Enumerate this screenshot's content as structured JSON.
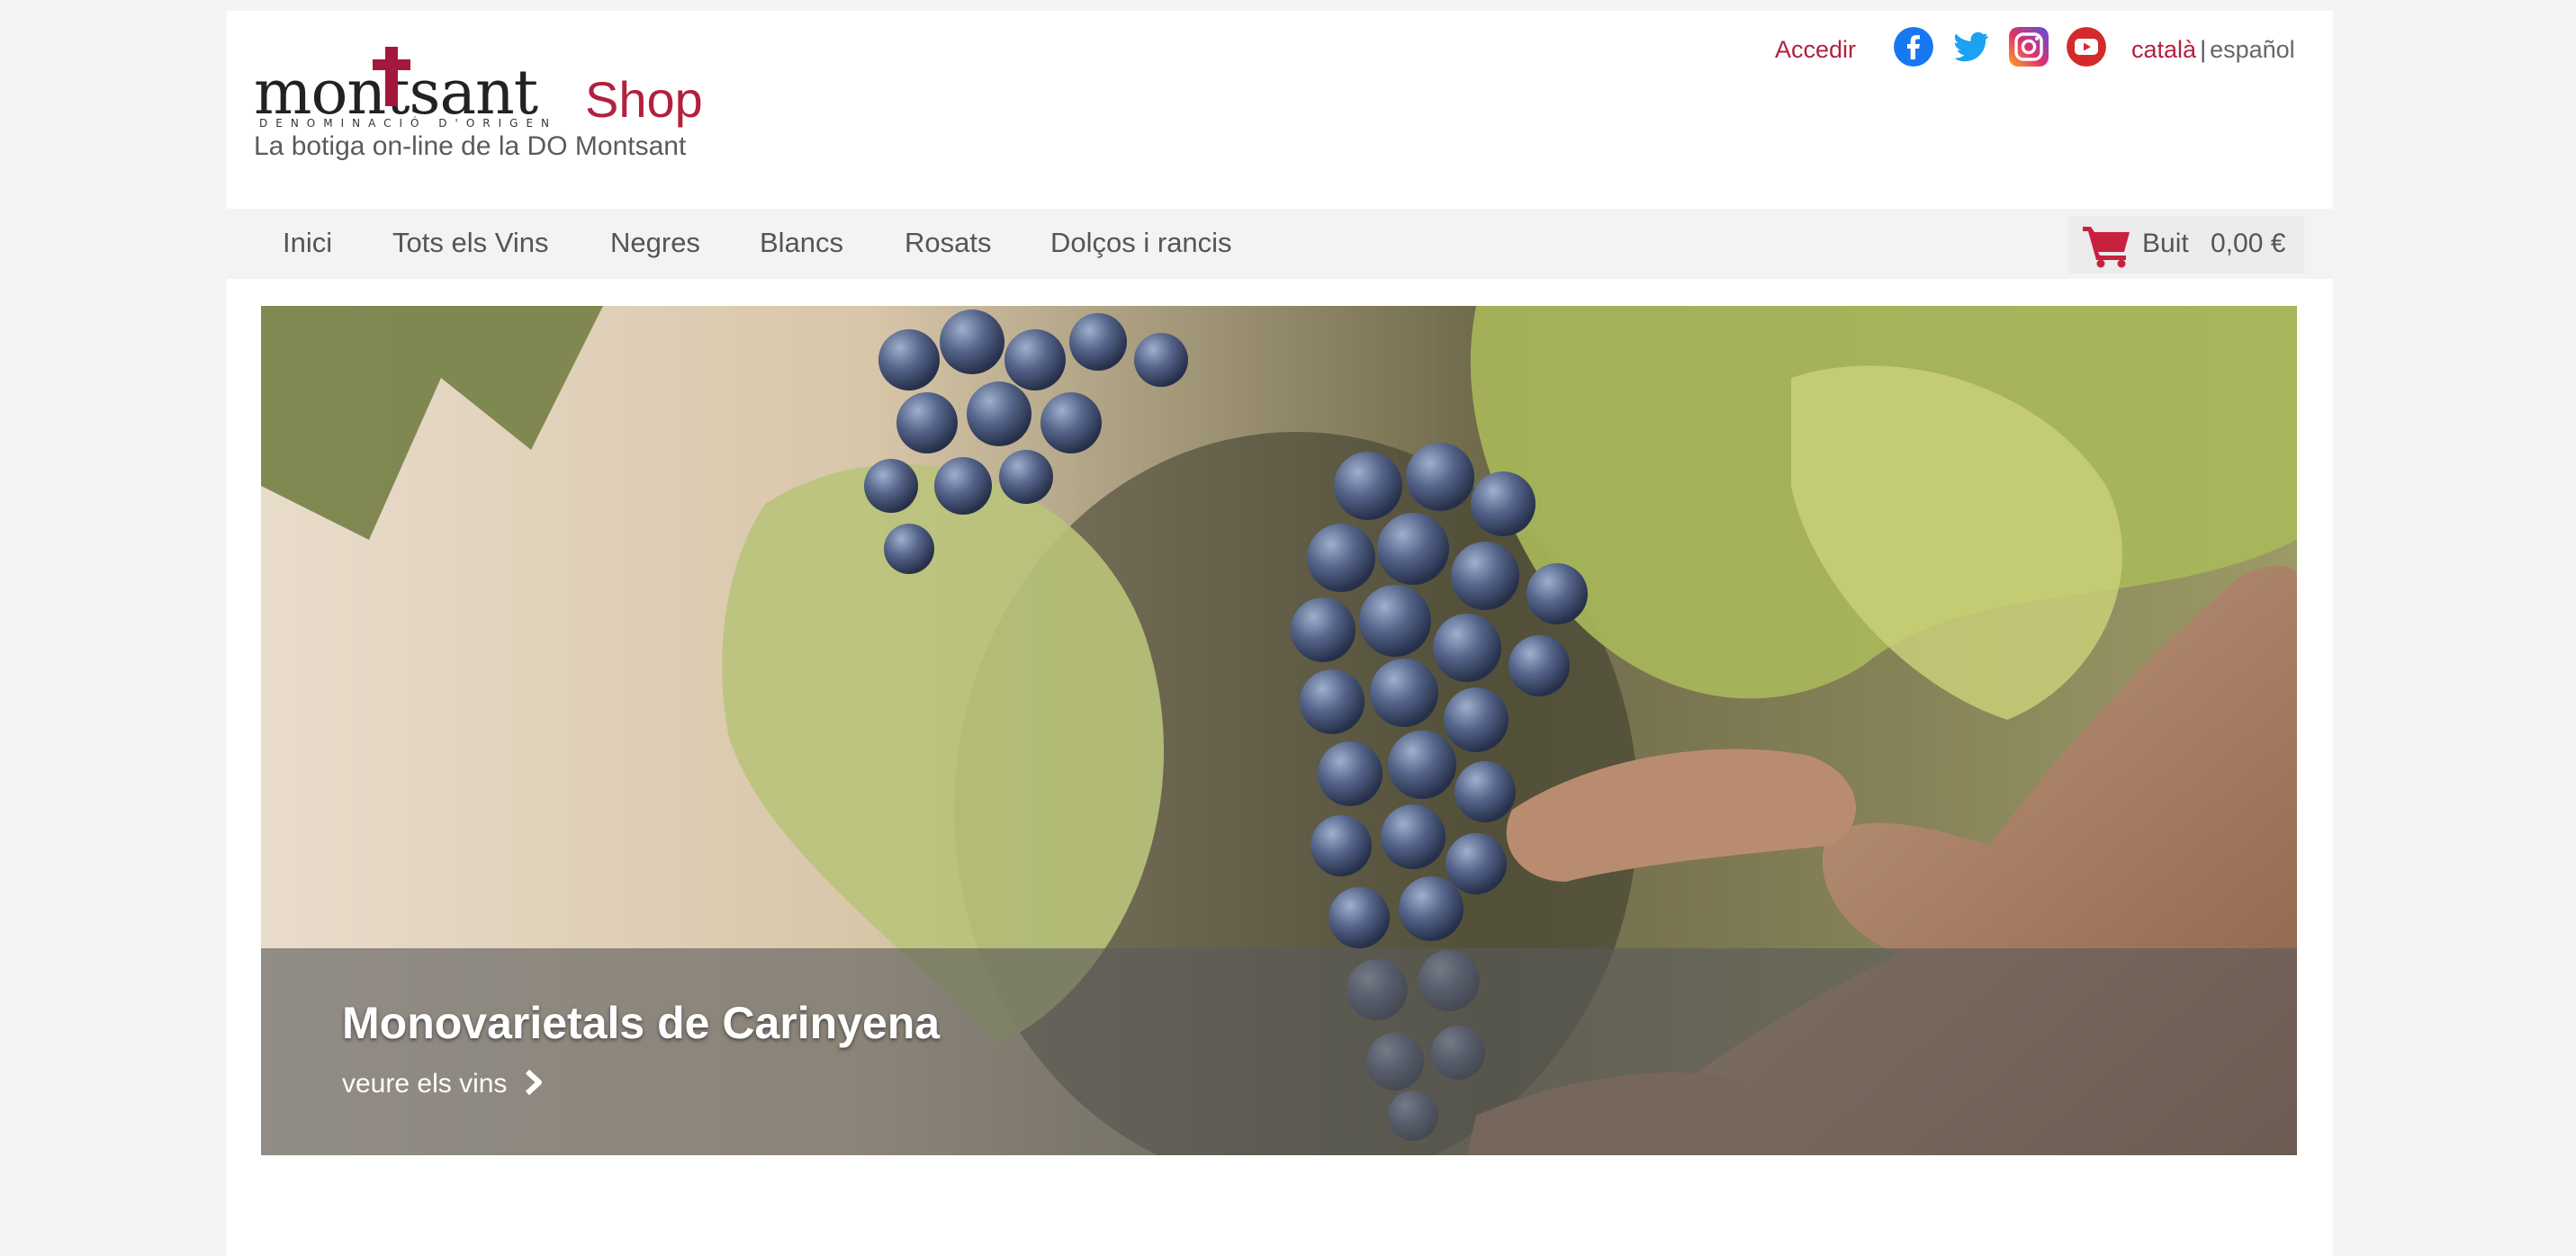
{
  "header": {
    "logo_text": "montsant",
    "logo_subtext": "DENOMINACIÓ D'ORIGEN",
    "shop_label": "Shop",
    "tagline": "La botiga on-line de la DO Montsant",
    "login_label": "Accedir",
    "social_icons": [
      "facebook-icon",
      "twitter-icon",
      "instagram-icon",
      "youtube-icon"
    ],
    "languages": {
      "current": "català",
      "separator": "|",
      "other": "español"
    }
  },
  "nav": {
    "items": [
      "Inici",
      "Tots els Vins",
      "Negres",
      "Blancs",
      "Rosats",
      "Dolços i rancis"
    ]
  },
  "cart": {
    "icon": "cart-icon",
    "status": "Buit",
    "total": "0,00 €"
  },
  "hero": {
    "title": "Monovarietals de Carinyena",
    "link_label": "veure els vins",
    "link_icon": "chevron-right-icon"
  },
  "colors": {
    "accent": "#b3203e",
    "facebook": "#1877f2",
    "twitter": "#1da1f2",
    "youtube": "#d32b2b"
  }
}
